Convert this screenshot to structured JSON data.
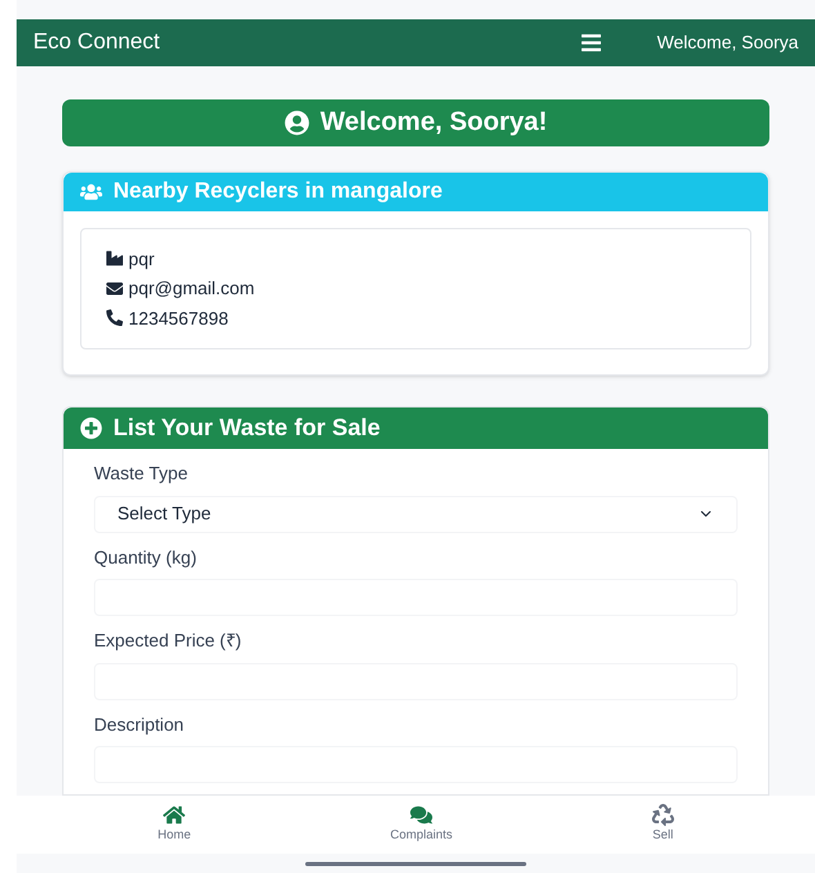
{
  "navbar": {
    "brand": "Eco Connect",
    "greeting": "Welcome, Soorya"
  },
  "welcome_banner": {
    "title": "Welcome, Soorya!"
  },
  "recyclers_card": {
    "title": "Nearby Recyclers in mangalore",
    "recyclers": [
      {
        "name": "pqr",
        "email": "pqr@gmail.com",
        "phone": "1234567898"
      }
    ]
  },
  "sale_form": {
    "title": "List Your Waste for Sale",
    "fields": [
      {
        "kind": "select",
        "label": "Waste Type",
        "value": "Select Type"
      },
      {
        "kind": "input",
        "label": "Quantity (kg)"
      },
      {
        "kind": "input",
        "label": "Expected Price (₹)"
      },
      {
        "kind": "input",
        "label": "Description"
      }
    ]
  },
  "bottom_nav": [
    {
      "label": "Home",
      "kind": "home"
    },
    {
      "label": "Complaints",
      "kind": "chat"
    },
    {
      "label": "Sell",
      "kind": "recycle"
    }
  ]
}
